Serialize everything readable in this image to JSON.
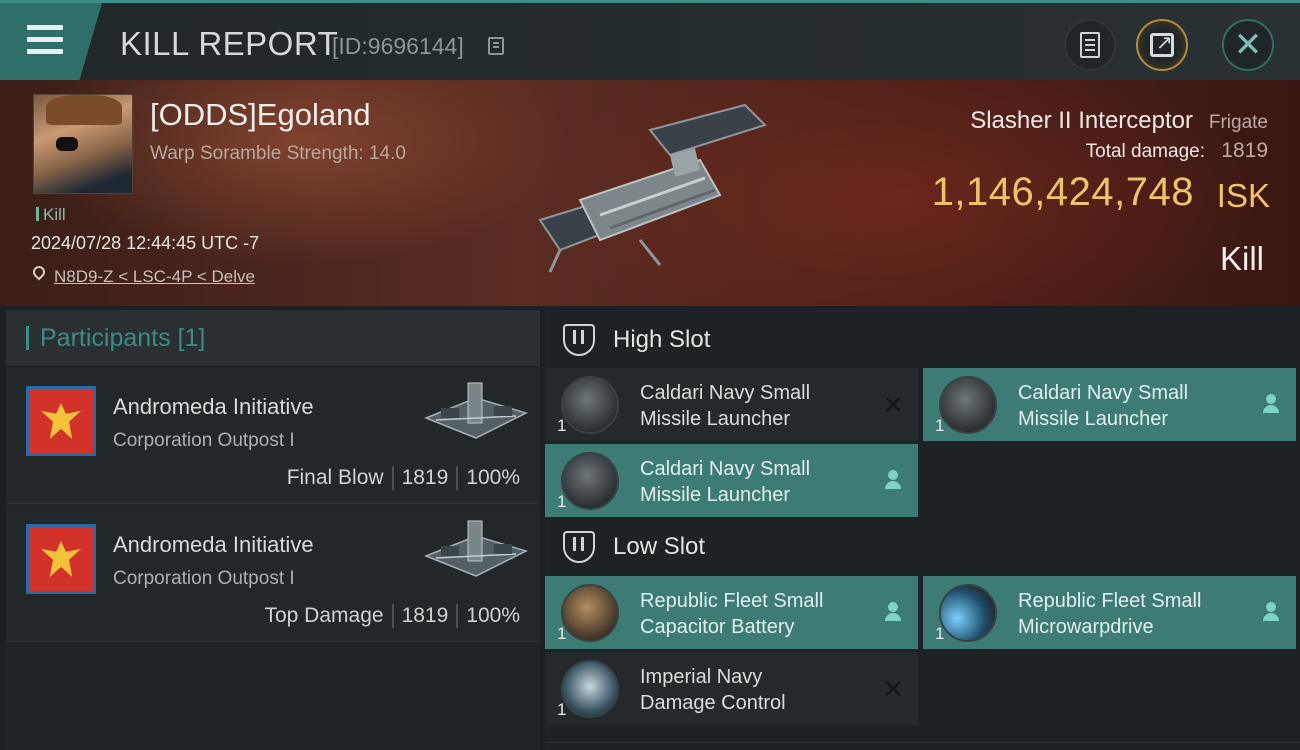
{
  "header": {
    "title": "KILL REPORT",
    "report_id": "[ID:9696144]"
  },
  "victim": {
    "name": "[ODDS]Egoland",
    "warp_scramble": "Warp Soramble Strength: 14.0",
    "tag": "Kill",
    "timestamp": "2024/07/28 12:44:45 UTC -7",
    "location": "N8D9-Z < LSC-4P < Delve"
  },
  "ship": {
    "name": "Slasher II Interceptor",
    "class": "Frigate",
    "total_damage_label": "Total damage:",
    "total_damage": "1819",
    "isk_value": "1,146,424,748",
    "isk_unit": "ISK",
    "result": "Kill"
  },
  "participants": {
    "header": "Participants [1]",
    "rows": [
      {
        "corp": "Andromeda Initiative",
        "ship": "Corporation Outpost I",
        "role": "Final Blow",
        "damage": "1819",
        "percent": "100%"
      },
      {
        "corp": "Andromeda Initiative",
        "ship": "Corporation Outpost I",
        "role": "Top Damage",
        "damage": "1819",
        "percent": "100%"
      }
    ]
  },
  "slots": {
    "high": {
      "title": "High Slot",
      "modules": [
        {
          "name_line1": "Caldari Navy Small",
          "name_line2": "Missile Launcher",
          "qty": "1",
          "status": "destroyed"
        },
        {
          "name_line1": "Caldari Navy Small",
          "name_line2": "Missile Launcher",
          "qty": "1",
          "status": "dropped"
        },
        {
          "name_line1": "Caldari Navy Small",
          "name_line2": "Missile Launcher",
          "qty": "1",
          "status": "dropped"
        }
      ]
    },
    "low": {
      "title": "Low Slot",
      "modules": [
        {
          "name_line1": "Republic Fleet Small",
          "name_line2": "Capacitor Battery",
          "qty": "1",
          "status": "dropped"
        },
        {
          "name_line1": "Republic Fleet Small",
          "name_line2": "Microwarpdrive",
          "qty": "1",
          "status": "dropped"
        },
        {
          "name_line1": "Imperial Navy",
          "name_line2": "Damage Control",
          "qty": "1",
          "status": "destroyed"
        }
      ]
    }
  },
  "colors": {
    "accent_teal": "#3d7c74",
    "isk_gold": "#f0c36a",
    "participants_header": "#3e8a86"
  }
}
